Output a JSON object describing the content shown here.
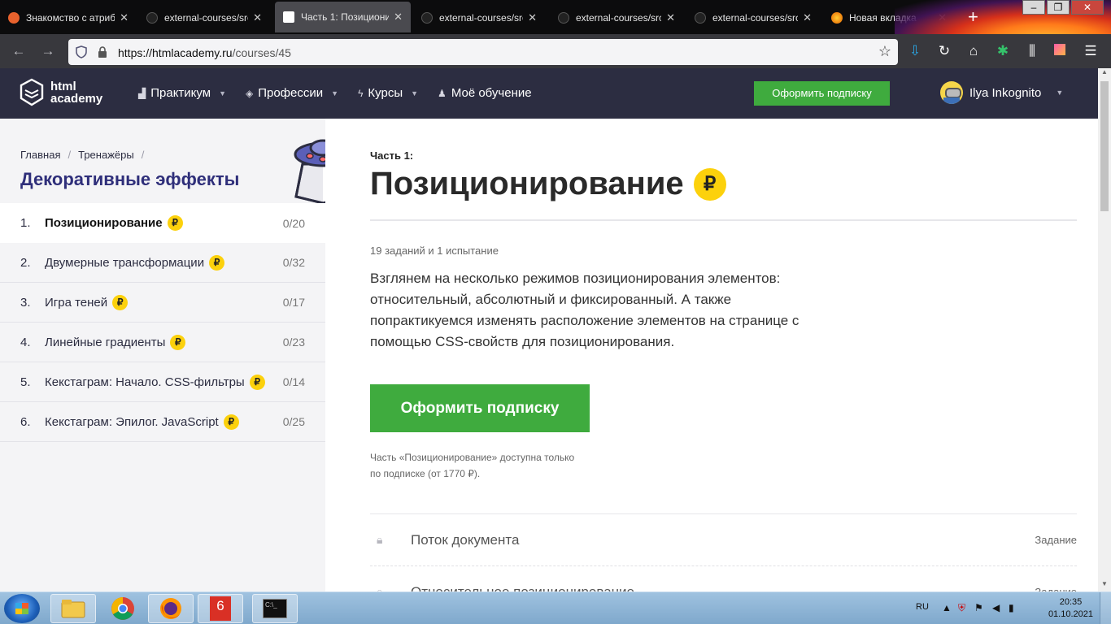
{
  "browser": {
    "tabs": [
      {
        "title": "Знакомство с атриб",
        "icon": "html-academy-icon"
      },
      {
        "title": "external-courses/src/",
        "icon": "github-icon"
      },
      {
        "title": "Часть 1: Позициони",
        "icon": "html-academy-icon",
        "active": true
      },
      {
        "title": "external-courses/src/",
        "icon": "github-icon"
      },
      {
        "title": "external-courses/src/",
        "icon": "github-icon"
      },
      {
        "title": "external-courses/src/",
        "icon": "github-icon"
      },
      {
        "title": "Новая вкладка",
        "icon": "firefox-icon"
      }
    ],
    "url_host": "https://htmlacademy.ru",
    "url_path": "/courses/45"
  },
  "header": {
    "logo_line1": "html",
    "logo_line2": "academy",
    "menu": [
      {
        "label": "Практикум",
        "icon": "chart-icon",
        "has_caret": true
      },
      {
        "label": "Профессии",
        "icon": "layers-icon",
        "has_caret": true
      },
      {
        "label": "Курсы",
        "icon": "lightning-icon",
        "has_caret": true
      },
      {
        "label": "Моё обучение",
        "icon": "users-icon",
        "has_caret": false
      }
    ],
    "subscribe_label": "Оформить подписку",
    "user_name": "Ilya Inkognito"
  },
  "sidebar": {
    "breadcrumb": [
      "Главная",
      "Тренажёры"
    ],
    "title": "Декоративные эффекты",
    "lessons": [
      {
        "num": "1.",
        "name": "Позиционирование",
        "progress": "0/20",
        "active": true
      },
      {
        "num": "2.",
        "name": "Двумерные трансформации",
        "progress": "0/32"
      },
      {
        "num": "3.",
        "name": "Игра теней",
        "progress": "0/17"
      },
      {
        "num": "4.",
        "name": "Линейные градиенты",
        "progress": "0/23"
      },
      {
        "num": "5.",
        "name": "Кекстаграм: Начало. CSS-фильтры",
        "progress": "0/14"
      },
      {
        "num": "6.",
        "name": "Кекстаграм: Эпилог. JavaScript",
        "progress": "0/25"
      }
    ],
    "coin_symbol": "₽"
  },
  "main": {
    "part_label": "Часть 1:",
    "title": "Позиционирование",
    "coin_symbol": "₽",
    "tasks_count": "19 заданий и 1 испытание",
    "description": "Взглянем на несколько режимов позиционирования элементов: относительный, абсолютный и фиксированный. А также попрактикуемся изменять расположение элементов на странице с помощью CSS-свойств для позиционирования.",
    "subscribe_label": "Оформить подписку",
    "note_line1": "Часть «Позиционирование» доступна только",
    "note_line2": "по подписке (от 1770 ₽).",
    "tasks": [
      {
        "name": "Поток документа",
        "type": "Задание"
      },
      {
        "name": "Относительное позиционирование",
        "type": "Задание"
      }
    ]
  },
  "taskbar": {
    "lang": "RU",
    "time": "20:35",
    "date": "01.10.2021",
    "app_badge": "6"
  },
  "colors": {
    "header_bg": "#2c2d41",
    "accent_green": "#3fab3e",
    "coin_yellow": "#fcd10c",
    "title_purple": "#2f2f7a"
  }
}
